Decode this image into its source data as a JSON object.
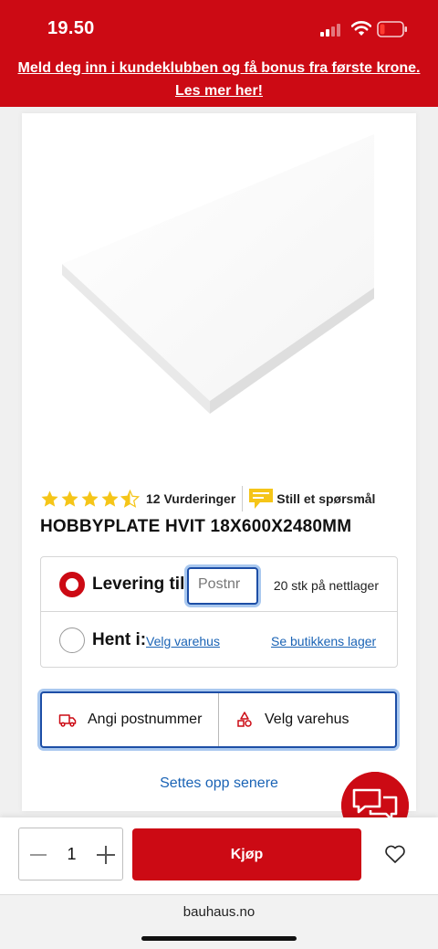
{
  "status_bar": {
    "time": "19.50",
    "signal_bars": 2,
    "battery_level": 0.15
  },
  "banner": {
    "line1": "Meld deg inn i kundeklubben og få bonus fra første krone.",
    "line2": "Les mer her!"
  },
  "product": {
    "rating": 4.5,
    "reviews_label": "12 Vurderinger",
    "ask_label": "Still et spørsmål",
    "title": "HOBBYPLATE HVIT 18X600X2480MM"
  },
  "delivery": {
    "label": "Levering til:",
    "postnr_placeholder": "Postnr",
    "stock": "20 stk på nettlager",
    "selected": true
  },
  "pickup": {
    "label": "Hent i:",
    "store_link": "Velg varehus",
    "stock_link": "Se butikkens lager",
    "selected": false
  },
  "toggle": {
    "postcode_label": "Angi postnummer",
    "store_label": "Velg varehus"
  },
  "later_link": "Settes opp senere",
  "buy": {
    "quantity": "1",
    "button_label": "Kjøp"
  },
  "browser": {
    "url": "bauhaus.no"
  },
  "colors": {
    "brand_red": "#cc0a14",
    "link_blue": "#1a63b5",
    "star_yellow": "#f5c518",
    "focus_blue": "#1d4ea6"
  }
}
